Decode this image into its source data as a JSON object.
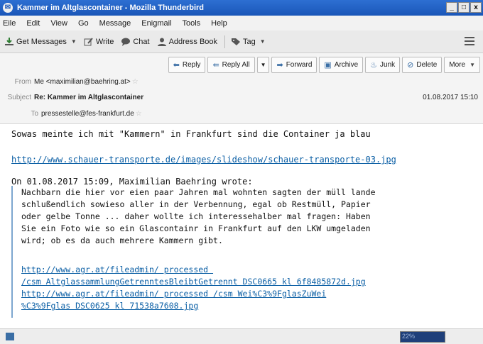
{
  "window": {
    "title": "Kammer im Altglascontainer - Mozilla Thunderbird",
    "controls": [
      "_",
      "□",
      "x"
    ]
  },
  "menu": [
    "Eile",
    "Edit",
    "View",
    "Go",
    "Message",
    "Enigmail",
    "Tools",
    "Help"
  ],
  "toolbar": {
    "get_messages": "Get Messages",
    "write": "Write",
    "chat": "Chat",
    "address_book": "Address Book",
    "tag": "Tag"
  },
  "actions": {
    "reply": "Reply",
    "reply_all": "Reply All",
    "forward": "Forward",
    "archive": "Archive",
    "junk": "Junk",
    "delete": "Delete",
    "more": "More"
  },
  "header": {
    "from_label": "From",
    "from_value": "Me <maximilian@baehring.at>",
    "subject_label": "Subject",
    "subject_value": "Re: Kammer im Altglascontainer",
    "date": "01.08.2017 15:10",
    "to_label": "To",
    "to_value": "pressestelle@fes-frankfurt.de"
  },
  "message": {
    "line1": "Sowas meinte ich mit \"Kammern\" in Frankfurt sind die Container ja blau",
    "link1": "http://www.schauer-transporte.de/images/slideshow/schauer-transporte-03.jpg",
    "attribution": "On 01.08.2017 15:09, Maximilian Baehring wrote:",
    "quote_lines": [
      "Nachbarn die hier vor eien paar Jahren mal wohnten sagten der müll lande",
      "schlußendlich sowieso aller in der Verbennung, egal ob Restmüll, Papier",
      "oder gelbe Tonne ... daher wollte ich interessehalber mal fragen: Haben",
      "Sie ein Foto wie so ein Glascontainr in Frankfurt auf den LKW umgeladen",
      "wird; ob es da auch mehrere Kammern gibt."
    ],
    "quote_links": [
      "http://www.agr.at/fileadmin/ processed ",
      "/csm AltglassammlungGetrenntesBleibtGetrennt DSC0665 kl 6f8485872d.jpg",
      "http://www.agr.at/fileadmin/ processed /csm Wei%C3%9FglasZuWei",
      "%C3%9Fglas DSC0625 kl 71538a7608.jpg"
    ]
  },
  "status": {
    "progress_label": "22%"
  },
  "colors": {
    "titlebar": "#1a56b8",
    "link": "#0b5fa5",
    "quote_bar": "#7da6cf"
  }
}
